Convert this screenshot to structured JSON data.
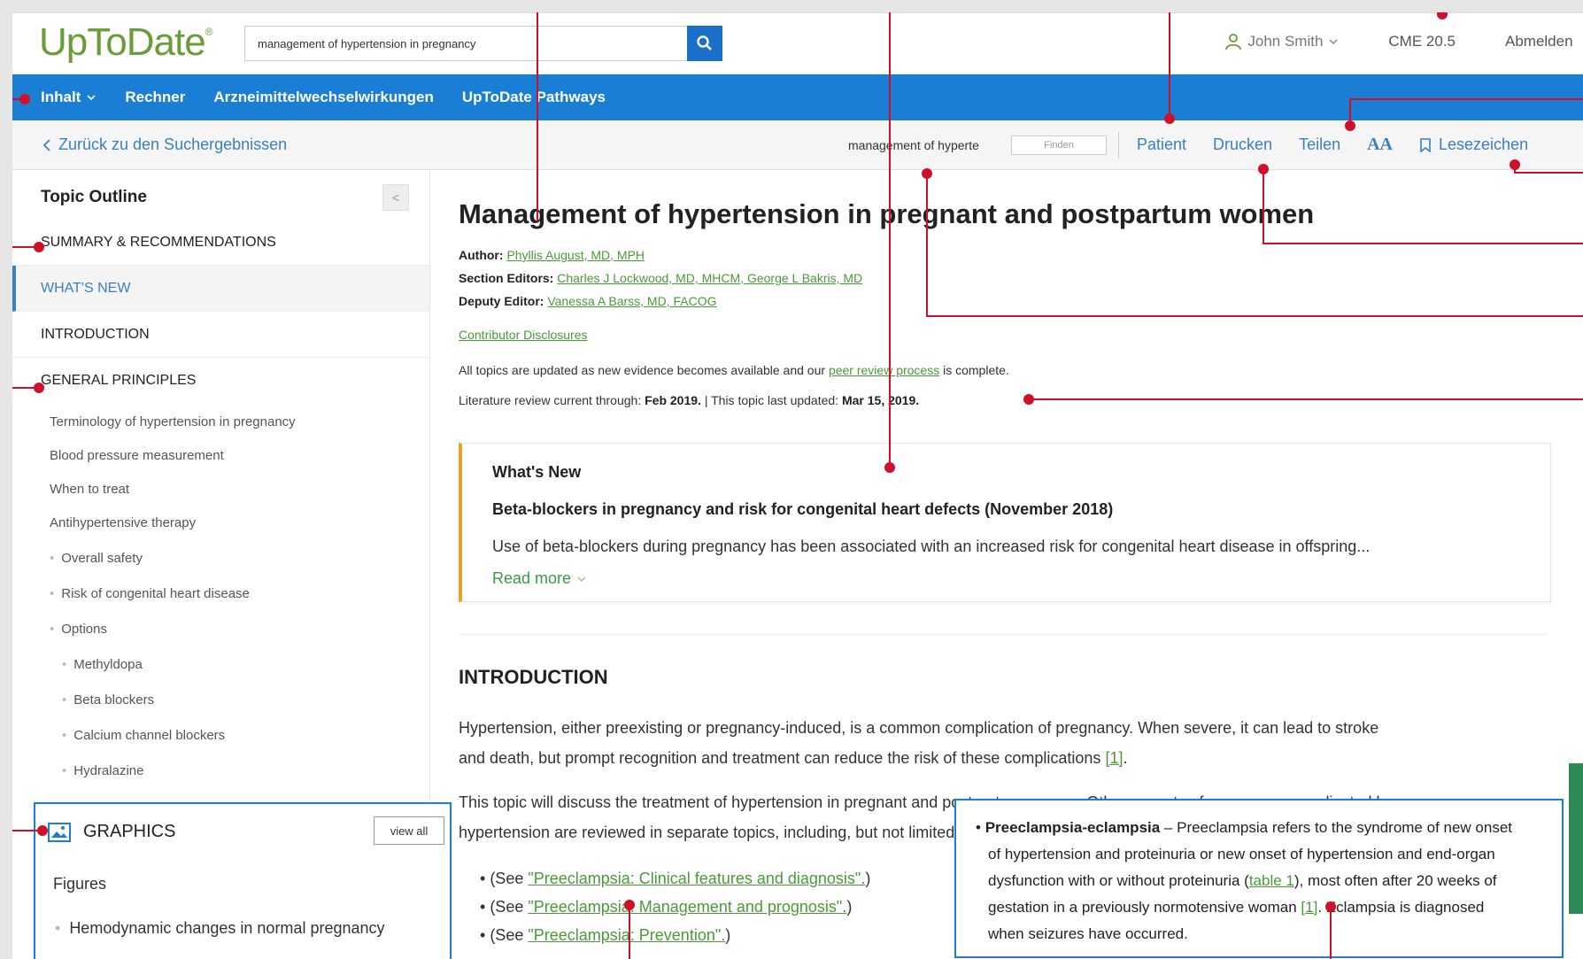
{
  "header": {
    "logo": "UpToDate",
    "logo_mark": "®",
    "search_value": "management of hypertension in pregnancy",
    "user_name": "John Smith",
    "cme": "CME 20.5",
    "logout": "Abmelden"
  },
  "nav": {
    "items": [
      "Inhalt",
      "Rechner",
      "Arzneimittelwechselwirkungen",
      "UpToDate Pathways"
    ]
  },
  "toolbar": {
    "back": "Zurück zu den Suchergebnissen",
    "find_value": "management of hyperte",
    "find_button": "Finden",
    "patient": "Patient",
    "print": "Drucken",
    "share": "Teilen",
    "font_size": "AA",
    "bookmark": "Lesezeichen"
  },
  "outline": {
    "heading": "Topic Outline",
    "collapse": "<",
    "sections": [
      "SUMMARY & RECOMMENDATIONS",
      "WHAT'S NEW",
      "INTRODUCTION",
      "GENERAL PRINCIPLES"
    ],
    "subs": [
      "Terminology of hypertension in pregnancy",
      "Blood pressure measurement",
      "When to treat",
      "Antihypertensive therapy"
    ],
    "subsubs": [
      "Overall safety",
      "Risk of congenital heart disease",
      "Options"
    ],
    "options": [
      "Methyldopa",
      "Beta blockers",
      "Calcium channel blockers",
      "Hydralazine"
    ]
  },
  "graphics": {
    "title": "GRAPHICS",
    "view_all": "view all",
    "figures_label": "Figures",
    "item": "Hemodynamic changes in normal pregnancy"
  },
  "article": {
    "title": "Management of hypertension in pregnant and postpartum women",
    "author_label": "Author:",
    "author": "Phyllis August, MD, MPH",
    "editors_label": "Section Editors:",
    "editors": "Charles J Lockwood, MD, MHCM, George L Bakris, MD",
    "deputy_label": "Deputy Editor:",
    "deputy": "Vanessa A Barss, MD, FACOG",
    "disclosures": "Contributor Disclosures",
    "updated_pre": "All topics are updated as new evidence becomes available and our ",
    "updated_link": "peer review process",
    "updated_post": " is complete.",
    "lit_pre": "Literature review current through: ",
    "lit_date": "Feb 2019.",
    "lit_mid": " | This topic last updated: ",
    "lit_updated": "Mar 15, 2019.",
    "whats_new_label": "What's New",
    "whats_new_head": "Beta-blockers in pregnancy and risk for congenital heart defects (November 2018)",
    "whats_new_body": "Use of beta-blockers during pregnancy has been associated with an increased risk for congenital heart disease in offspring...",
    "read_more": "Read more",
    "intro_heading": "INTRODUCTION",
    "intro_p1a": "Hypertension, either preexisting or pregnancy-induced, is a common complication of pregnancy. When severe, it can lead to stroke",
    "intro_p1b": "and death, but prompt recognition and treatment can reduce the risk of these complications ",
    "intro_ref": "[1]",
    "intro_p2a": "This topic will discuss the treatment of hypertension in pregnant and postpartum women. Other aspects of pregnancy complicated by",
    "intro_p2b": "hypertension are reviewed in separate topics, including, but not limited to:",
    "see": "(See ",
    "bullet1": "\"Preeclampsia: Clinical features and diagnosis\".",
    "bullet2": "\"Preeclampsia: Management and prognosis\".",
    "bullet3": "\"Preeclampsia: Prevention\".",
    "close_paren": ")"
  },
  "popup": {
    "term": "Preeclampsia-eclampsia",
    "text1": " – Preeclampsia refers to the syndrome of new onset",
    "text2": "of hypertension and proteinuria or new onset of hypertension and end-organ",
    "text3a": "dysfunction with or without proteinuria (",
    "table_link": "table 1",
    "text3b": "), most often after 20 weeks of",
    "text4a": "gestation in a previously normotensive woman ",
    "ref": "[1]",
    "text4b": ". Eclampsia is diagnosed",
    "text5": "when seizures have occurred."
  },
  "colors": {
    "brand_green": "#6a9c3a",
    "nav_blue": "#1a7ed4",
    "link_blue": "#3a7fc1",
    "link_green": "#4a9a3a",
    "accent_orange": "#e8a030",
    "callout_red": "#d0102a"
  }
}
